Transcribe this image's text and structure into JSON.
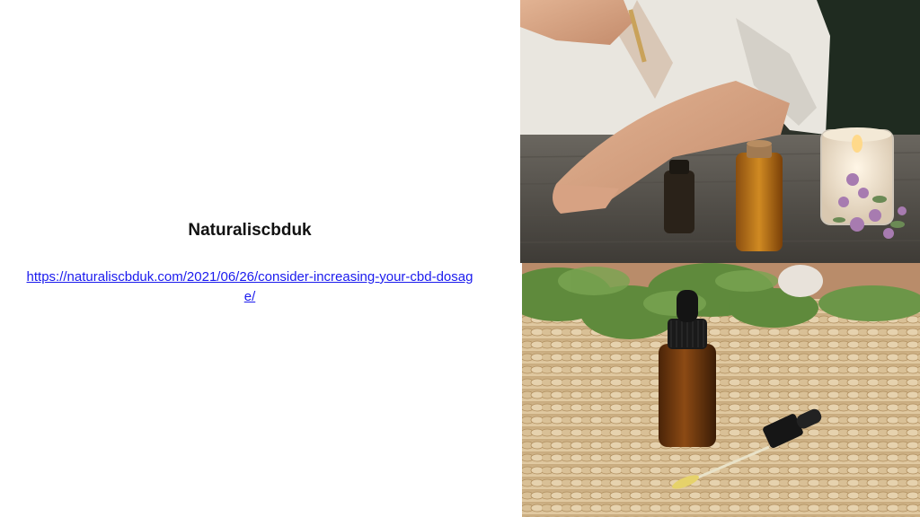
{
  "slide": {
    "title": "Naturaliscbduk",
    "link_text": "https://naturaliscbduk.com/2021/06/26/consider-increasing-your-cbd-dosage/"
  },
  "images": {
    "top_photo_icon": "photo-icon",
    "bottom_photo_icon": "photo-icon"
  },
  "colors": {
    "link": "#1a1aee",
    "title": "#111111",
    "background": "#ffffff"
  }
}
